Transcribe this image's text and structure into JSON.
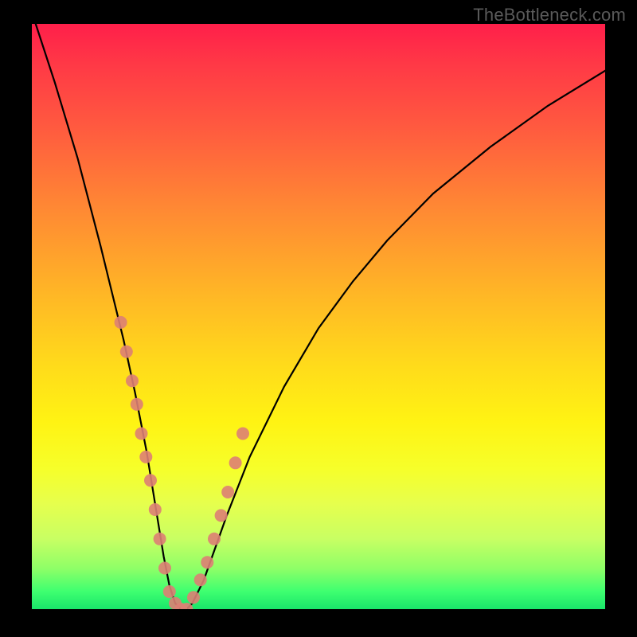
{
  "watermark": "TheBottleneck.com",
  "chart_data": {
    "type": "line",
    "title": "",
    "xlabel": "",
    "ylabel": "",
    "xlim": [
      0,
      100
    ],
    "ylim": [
      0,
      100
    ],
    "series": [
      {
        "name": "bottleneck-curve",
        "x": [
          0,
          4,
          8,
          12,
          14,
          16,
          18,
          20,
          22,
          23,
          24,
          25,
          26,
          27,
          28,
          30,
          34,
          38,
          44,
          50,
          56,
          62,
          70,
          80,
          90,
          100
        ],
        "y": [
          102,
          90,
          77,
          62,
          54,
          46,
          37,
          27,
          15,
          9,
          4,
          1,
          0,
          0,
          1,
          5,
          16,
          26,
          38,
          48,
          56,
          63,
          71,
          79,
          86,
          92
        ]
      }
    ],
    "markers": {
      "name": "highlight-dots",
      "x": [
        15.5,
        16.5,
        17.5,
        18.3,
        19.1,
        19.9,
        20.7,
        21.5,
        22.3,
        23.2,
        24.0,
        25.0,
        26.0,
        27.0,
        28.2,
        29.4,
        30.6,
        31.8,
        33.0,
        34.2,
        35.5,
        36.8
      ],
      "y": [
        49,
        44,
        39,
        35,
        30,
        26,
        22,
        17,
        12,
        7,
        3,
        1,
        0,
        0,
        2,
        5,
        8,
        12,
        16,
        20,
        25,
        30
      ]
    },
    "gradient_stops": [
      {
        "pos": 0,
        "color": "#ff1f4a"
      },
      {
        "pos": 46,
        "color": "#ffb626"
      },
      {
        "pos": 76,
        "color": "#f6ff2a"
      },
      {
        "pos": 100,
        "color": "#19e56a"
      }
    ]
  }
}
